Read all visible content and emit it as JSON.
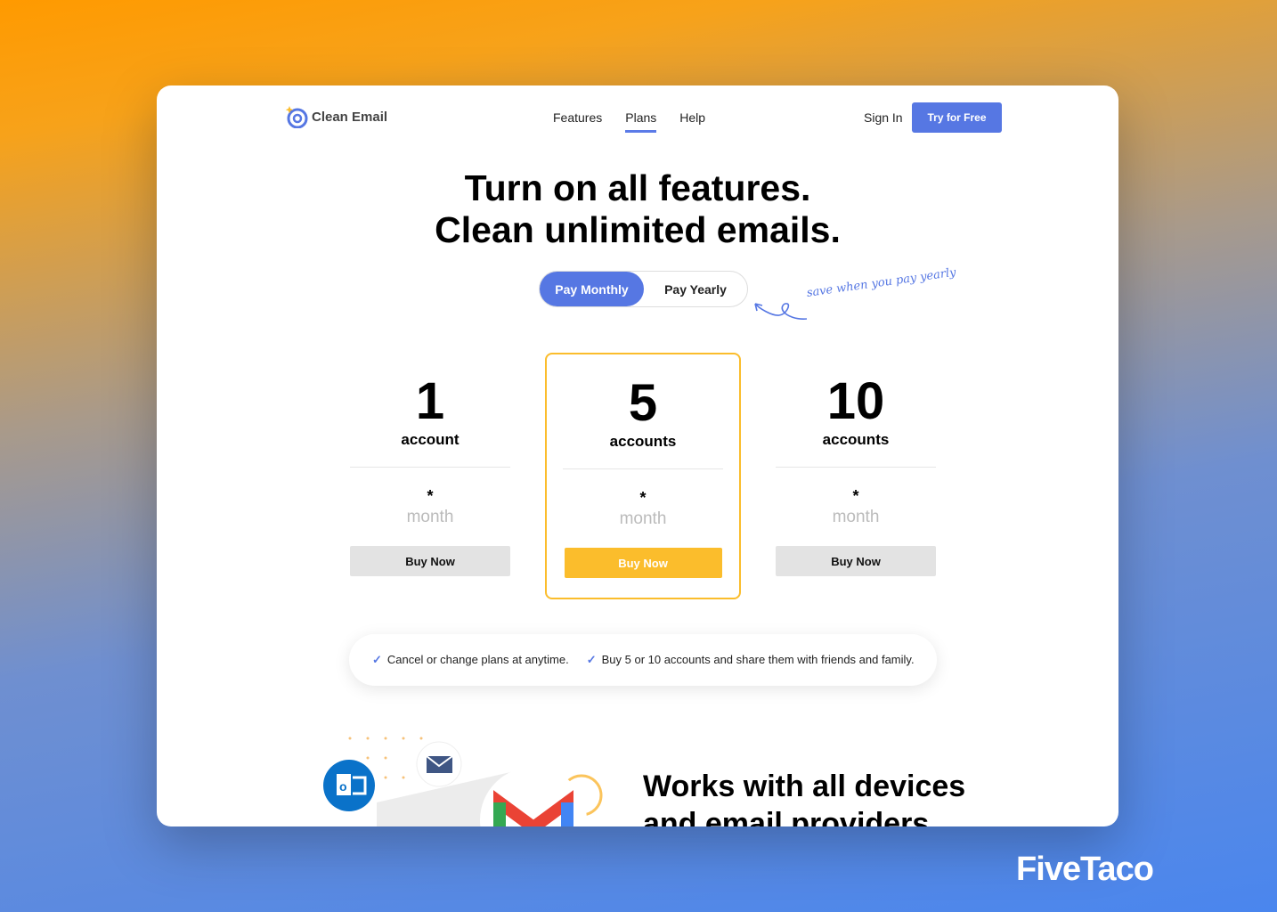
{
  "brand": {
    "name": "Clean Email"
  },
  "nav": {
    "items": [
      "Features",
      "Plans",
      "Help"
    ],
    "active": "Plans",
    "sign_in": "Sign In",
    "try": "Try for Free"
  },
  "hero": {
    "line1": "Turn on all features.",
    "line2": "Clean unlimited emails."
  },
  "billing": {
    "monthly": "Pay Monthly",
    "yearly": "Pay Yearly",
    "selected": "Pay Monthly",
    "note": "save when you pay yearly"
  },
  "plans": [
    {
      "count": "1",
      "unit": "account",
      "price": "*",
      "period": "month",
      "button": "Buy Now"
    },
    {
      "count": "5",
      "unit": "accounts",
      "price": "*",
      "period": "month",
      "button": "Buy Now",
      "featured": true
    },
    {
      "count": "10",
      "unit": "accounts",
      "price": "*",
      "period": "month",
      "button": "Buy Now"
    }
  ],
  "benefits": [
    "Cancel or change plans at anytime.",
    "Buy 5 or 10 accounts and share them with friends and family."
  ],
  "section": {
    "line1": "Works with all devices",
    "line2": "and email providers"
  },
  "watermark": "FiveTaco",
  "colors": {
    "accent": "#5677e3",
    "featured": "#fbbd2c"
  }
}
